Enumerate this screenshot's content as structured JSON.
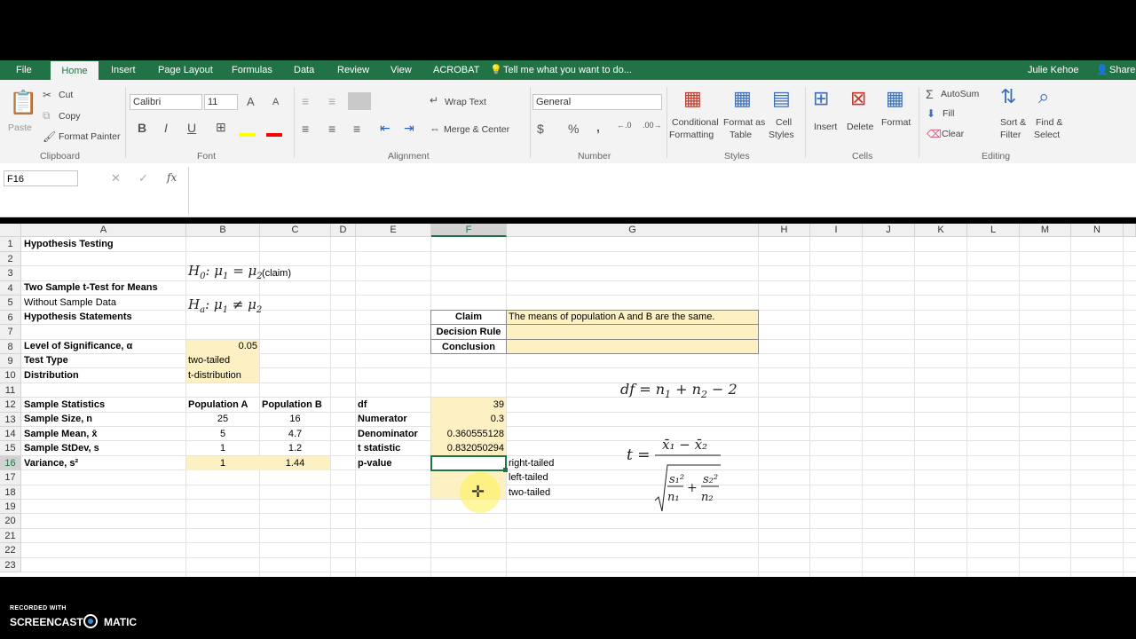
{
  "ribbon_tabs": [
    "File",
    "Home",
    "Insert",
    "Page Layout",
    "Formulas",
    "Data",
    "Review",
    "View",
    "ACROBAT"
  ],
  "tell_me": "Tell me what you want to do...",
  "user": "Julie Kehoe",
  "share": "Share",
  "clipboard": {
    "paste": "Paste",
    "cut": "Cut",
    "copy": "Copy",
    "format_painter": "Format Painter",
    "group": "Clipboard"
  },
  "font": {
    "name": "Calibri",
    "size": "11",
    "group": "Font",
    "bold": "B",
    "italic": "I",
    "underline": "U"
  },
  "alignment": {
    "wrap": "Wrap Text",
    "merge": "Merge & Center",
    "group": "Alignment"
  },
  "number": {
    "format": "General",
    "group": "Number",
    "dollar": "$",
    "percent": "%",
    "comma": ","
  },
  "styles": {
    "cond1": "Conditional",
    "cond2": "Formatting",
    "fmt1": "Format as",
    "fmt2": "Table",
    "cell1": "Cell",
    "cell2": "Styles",
    "group": "Styles"
  },
  "cells": {
    "insert": "Insert",
    "delete": "Delete",
    "format": "Format",
    "group": "Cells"
  },
  "editing": {
    "autosum": "AutoSum",
    "fill": "Fill",
    "clear": "Clear",
    "sort1": "Sort &",
    "sort2": "Filter",
    "find1": "Find &",
    "find2": "Select",
    "group": "Editing"
  },
  "namebox": "F16",
  "fx": "fx",
  "columns": [
    "A",
    "B",
    "C",
    "D",
    "E",
    "F",
    "G",
    "H",
    "I",
    "J",
    "K",
    "L",
    "M",
    "N"
  ],
  "rows": [
    "1",
    "2",
    "3",
    "4",
    "5",
    "6",
    "7",
    "8",
    "9",
    "10",
    "11",
    "12",
    "13",
    "14",
    "15",
    "16",
    "17",
    "18",
    "19",
    "20",
    "21",
    "22",
    "23"
  ],
  "cells_data": {
    "a1": "Hypothesis Testing",
    "a4": "Two Sample t-Test for Means",
    "a5": "Without Sample Data",
    "a6": "Hypothesis Statements",
    "a8": "Level of Significance, α",
    "b8": "0.05",
    "a9": "Test Type",
    "b9": "two-tailed",
    "a10": "Distribution",
    "b10": "t-distribution",
    "a12": "Sample Statistics",
    "b12": "Population A",
    "c12": "Population B",
    "a13": "Sample Size, n",
    "b13": "25",
    "c13": "16",
    "a14": "Sample Mean, x̄",
    "b14": "5",
    "c14": "4.7",
    "a15": "Sample StDev, s",
    "b15": "1",
    "c15": "1.2",
    "a16": "Variance, s²",
    "b16": "1",
    "c16": "1.44",
    "e12": "df",
    "f12": "39",
    "e13": "Numerator",
    "f13": "0.3",
    "e14": "Denominator",
    "f14": "0.360555128",
    "e15": "t statistic",
    "f15": "0.832050294",
    "e16": "p-value",
    "g16": "right-tailed",
    "g17": "left-tailed",
    "g18": "two-tailed",
    "e6": "Claim",
    "f6": "The means of population A and B are the same.",
    "e7": "Decision Rule",
    "e8": "Conclusion"
  },
  "claim_tag": "(claim)",
  "recorded_with": "RECORDED WITH",
  "brand": "SCREENCAST",
  "brand2": "MATIC"
}
